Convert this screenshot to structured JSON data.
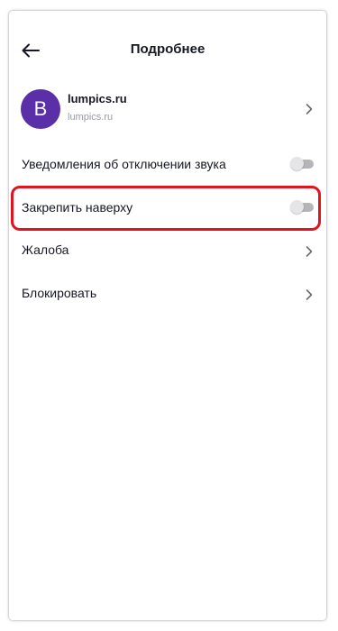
{
  "header": {
    "title": "Подробнее",
    "back_icon": "arrow-left-icon"
  },
  "profile": {
    "avatar_letter": "B",
    "avatar_color": "#5a2fa8",
    "name": "lumpics.ru",
    "username": "lumpics.ru",
    "chevron_icon": "chevron-right-icon"
  },
  "settings": {
    "mute_notifications": {
      "label": "Уведомления об отключении звука",
      "enabled": false
    },
    "pin_to_top": {
      "label": "Закрепить наверху",
      "enabled": false,
      "highlighted": true
    },
    "report": {
      "label": "Жалоба"
    },
    "block": {
      "label": "Блокировать"
    }
  },
  "colors": {
    "highlight_border": "#e0151f",
    "toggle_track": "#b4b5b8",
    "toggle_knob": "#e5e5e7"
  }
}
